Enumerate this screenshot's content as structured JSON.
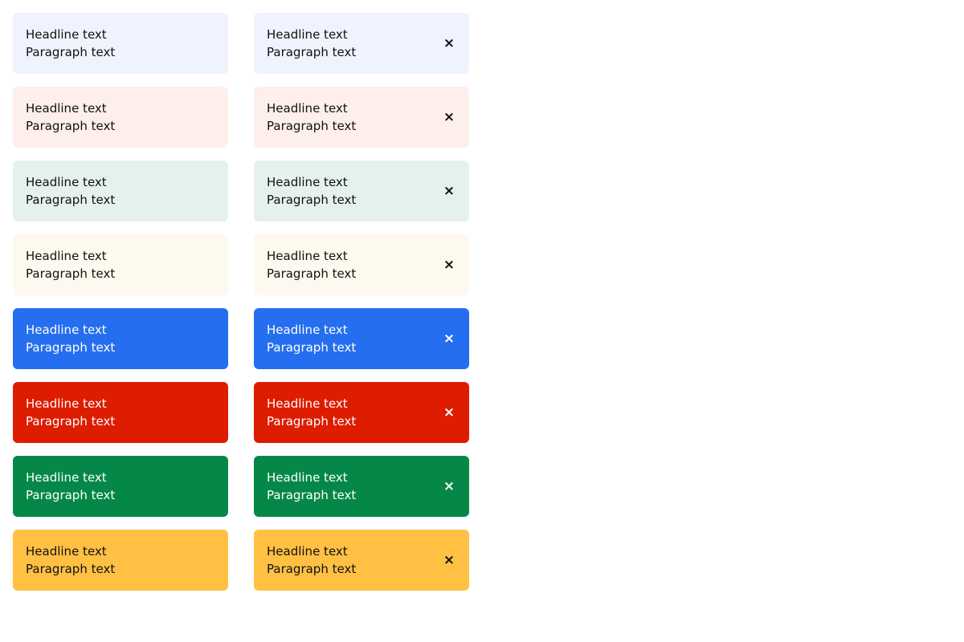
{
  "banners": [
    {
      "variant": "info-light",
      "headline": "Headline text",
      "paragraph": "Paragraph text",
      "bg": "#eef3fe",
      "fg": "#111111"
    },
    {
      "variant": "error-light",
      "headline": "Headline text",
      "paragraph": "Paragraph text",
      "bg": "#feefec",
      "fg": "#111111"
    },
    {
      "variant": "success-light",
      "headline": "Headline text",
      "paragraph": "Paragraph text",
      "bg": "#e5f2ec",
      "fg": "#111111"
    },
    {
      "variant": "warning-light",
      "headline": "Headline text",
      "paragraph": "Paragraph text",
      "bg": "#fef9ee",
      "fg": "#111111"
    },
    {
      "variant": "info-strong",
      "headline": "Headline text",
      "paragraph": "Paragraph text",
      "bg": "#256eef",
      "fg": "#ffffff"
    },
    {
      "variant": "error-strong",
      "headline": "Headline text",
      "paragraph": "Paragraph text",
      "bg": "#de1c00",
      "fg": "#ffffff"
    },
    {
      "variant": "success-strong",
      "headline": "Headline text",
      "paragraph": "Paragraph text",
      "bg": "#058847",
      "fg": "#ffffff"
    },
    {
      "variant": "warning-strong",
      "headline": "Headline text",
      "paragraph": "Paragraph text",
      "bg": "#ffc043",
      "fg": "#111111"
    }
  ],
  "close_glyph": "×",
  "close_icon": "close-icon"
}
